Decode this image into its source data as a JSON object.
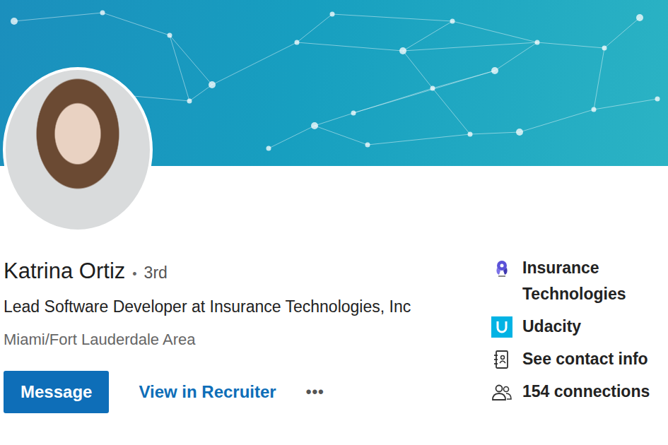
{
  "profile": {
    "name": "Katrina Ortiz",
    "degree_separator": "•",
    "degree": "3rd",
    "headline": "Lead Software Developer at Insurance Technologies, Inc",
    "location": "Miami/Fort Lauderdale Area"
  },
  "actions": [
    {
      "label": "Message",
      "kind": "primary"
    },
    {
      "label": "View in Recruiter",
      "kind": "link"
    },
    {
      "label": "•••",
      "kind": "more"
    }
  ],
  "sidebar": {
    "items": [
      {
        "label": "Insurance Technologies",
        "kind": "company"
      },
      {
        "label": "Udacity",
        "kind": "school"
      },
      {
        "label": "See contact info",
        "kind": "contact"
      },
      {
        "label": "154 connections",
        "kind": "connections"
      }
    ]
  }
}
